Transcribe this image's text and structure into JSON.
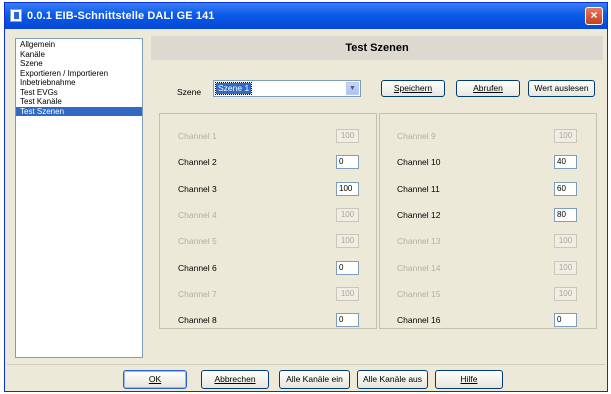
{
  "window": {
    "title": "0.0.1  EIB-Schnittstelle DALI GE 141",
    "close_label": "×"
  },
  "sidebar": {
    "items": [
      {
        "label": "Allgemein",
        "selected": false
      },
      {
        "label": "Kanäle",
        "selected": false
      },
      {
        "label": "Szene",
        "selected": false
      },
      {
        "label": "Exportieren / Importieren",
        "selected": false
      },
      {
        "label": "Inbetriebnahme",
        "selected": false
      },
      {
        "label": "Test EVGs",
        "selected": false
      },
      {
        "label": "Test Kanäle",
        "selected": false
      },
      {
        "label": "Test Szenen",
        "selected": true
      }
    ]
  },
  "panel": {
    "title": "Test Szenen",
    "scene_label": "Szene",
    "scene_value": "Szene 1",
    "buttons": {
      "save": "Speichern",
      "recall": "Abrufen",
      "read": "Wert auslesen"
    }
  },
  "channels_left": [
    {
      "label": "Channel 1",
      "value": "100",
      "enabled": false
    },
    {
      "label": "Channel 2",
      "value": "0",
      "enabled": true
    },
    {
      "label": "Channel 3",
      "value": "100",
      "enabled": true
    },
    {
      "label": "Channel 4",
      "value": "100",
      "enabled": false
    },
    {
      "label": "Channel 5",
      "value": "100",
      "enabled": false
    },
    {
      "label": "Channel 6",
      "value": "0",
      "enabled": true
    },
    {
      "label": "Channel 7",
      "value": "100",
      "enabled": false
    },
    {
      "label": "Channel 8",
      "value": "0",
      "enabled": true
    }
  ],
  "channels_right": [
    {
      "label": "Channel 9",
      "value": "100",
      "enabled": false
    },
    {
      "label": "Channel 10",
      "value": "40",
      "enabled": true
    },
    {
      "label": "Channel 11",
      "value": "60",
      "enabled": true
    },
    {
      "label": "Channel 12",
      "value": "80",
      "enabled": true
    },
    {
      "label": "Channel 13",
      "value": "100",
      "enabled": false
    },
    {
      "label": "Channel 14",
      "value": "100",
      "enabled": false
    },
    {
      "label": "Channel 15",
      "value": "100",
      "enabled": false
    },
    {
      "label": "Channel 16",
      "value": "0",
      "enabled": true
    }
  ],
  "footer": {
    "ok": "OK",
    "cancel": "Abbrechen",
    "all_on": "Alle Kanäle ein",
    "all_off": "Alle Kanäle aus",
    "help": "Hilfe"
  },
  "colors": {
    "title_bar": "#0a5ae8",
    "selection": "#316ac5",
    "dialog_bg": "#ece9d8"
  }
}
